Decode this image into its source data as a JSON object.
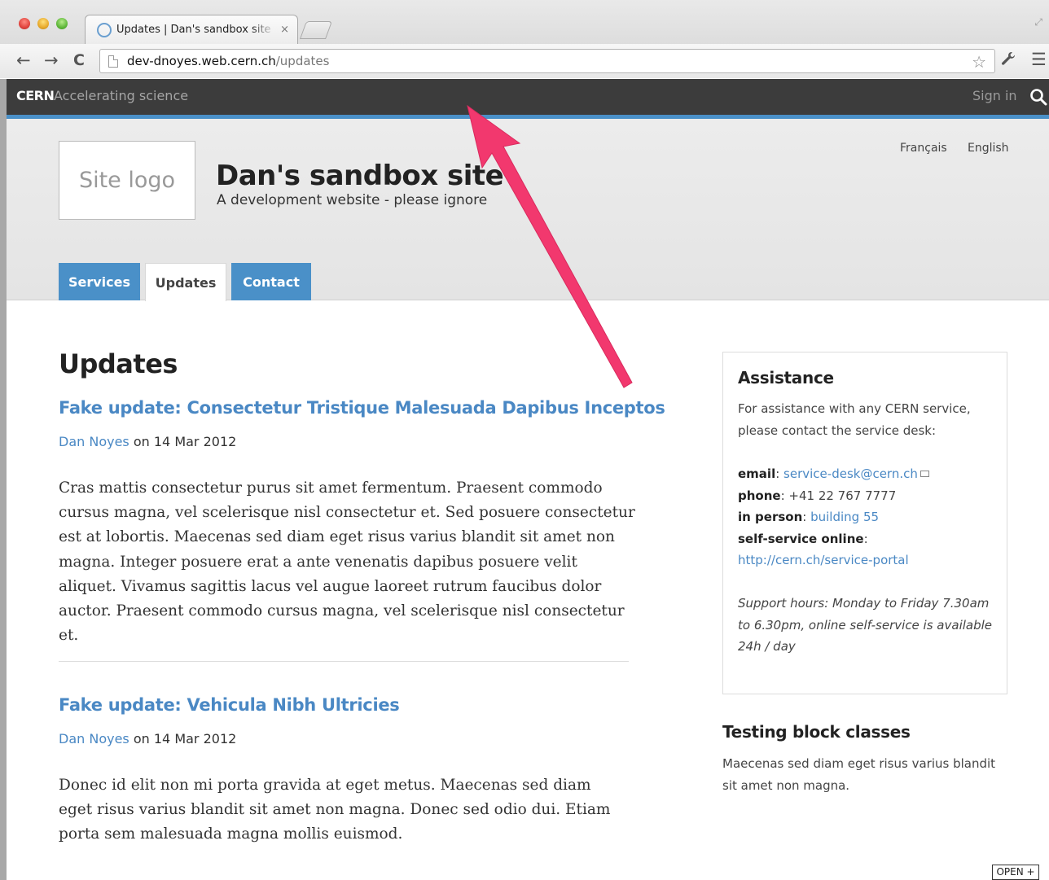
{
  "browser": {
    "tab_title": "Updates | Dan's sandbox site",
    "tab_close": "×",
    "url_host": "dev-dnoyes.web.cern.ch",
    "url_path": "/updates",
    "back": "←",
    "forward": "→",
    "reload": "C",
    "star": "☆",
    "wrench": "🔧",
    "menu": "☰",
    "resize": "⤢"
  },
  "cern_bar": {
    "brand": "CERN",
    "tagline": "Accelerating science",
    "signin": "Sign in"
  },
  "header": {
    "logo_text": "Site logo",
    "site_name": "Dan's sandbox site",
    "slogan": "A development website - please ignore",
    "languages": [
      "Français",
      "English"
    ],
    "tabs": [
      {
        "label": "Services",
        "active": false
      },
      {
        "label": "Updates",
        "active": true
      },
      {
        "label": "Contact",
        "active": false
      }
    ]
  },
  "main": {
    "title": "Updates",
    "articles": [
      {
        "title": "Fake update: Consectetur Tristique Malesuada Dapibus Inceptos",
        "author": "Dan Noyes",
        "date_text": " on 14 Mar 2012",
        "body": "Cras mattis consectetur purus sit amet fermentum. Praesent commodo cursus magna, vel scelerisque nisl consectetur et. Sed posuere consectetur est at lobortis. Maecenas sed diam eget risus varius blandit sit amet non magna. Integer posuere erat a ante venenatis dapibus posuere velit aliquet. Vivamus sagittis lacus vel augue laoreet rutrum faucibus dolor auctor. Praesent commodo cursus magna, vel scelerisque nisl consectetur et."
      },
      {
        "title": "Fake update: Vehicula Nibh Ultricies",
        "author": "Dan Noyes",
        "date_text": " on 14 Mar 2012",
        "body": "Donec id elit non mi porta gravida at eget metus. Maecenas sed diam eget risus varius blandit sit amet non magna. Donec sed odio dui. Etiam porta sem malesuada magna mollis euismod."
      }
    ]
  },
  "sidebar": {
    "assistance": {
      "title": "Assistance",
      "intro": "For assistance with any CERN service, please contact the service desk:",
      "email_label": "email",
      "email_value": "service-desk@cern.ch",
      "phone_label": "phone",
      "phone_value": "+41 22 767 7777",
      "person_label": "in person",
      "person_value": "building 55",
      "selfservice_label": "self-service online",
      "selfservice_value": "http://cern.ch/service-portal",
      "hours": "Support hours: Monday to Friday 7.30am to 6.30pm, online self-service is available 24h / day"
    },
    "testing": {
      "title": "Testing block classes",
      "text": "Maecenas sed diam eget risus varius blandit sit amet non magna."
    }
  },
  "open_badge": "OPEN +",
  "colors": {
    "accent_blue": "#4a90c8",
    "link_blue": "#4a88c4",
    "cern_bar": "#3c3c3c",
    "arrow_pink": "#f2386e"
  }
}
